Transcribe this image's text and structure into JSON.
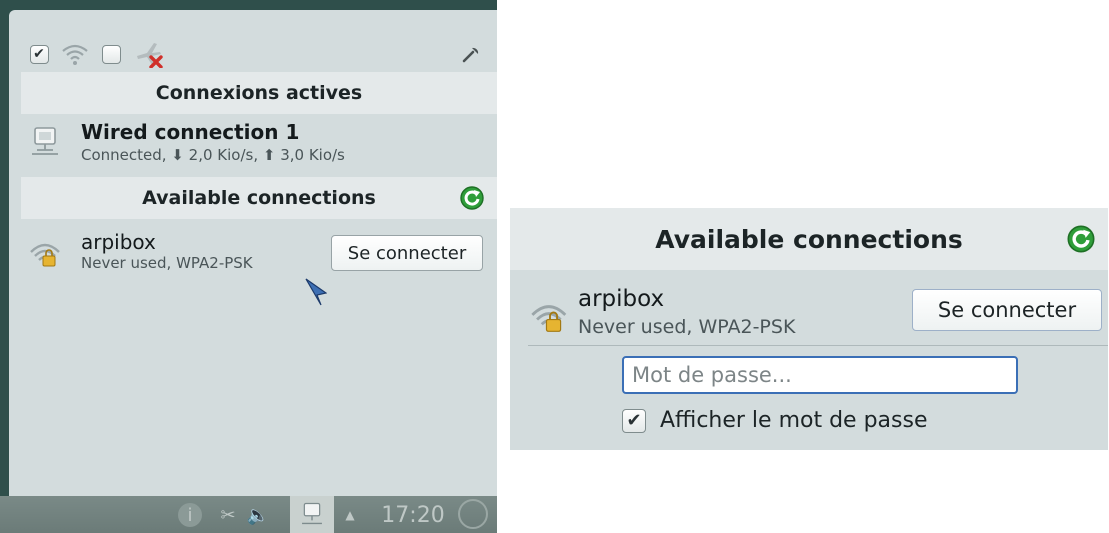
{
  "left": {
    "toolbar": {
      "networking_checkbox": "✔",
      "wifi_icon": "wifi-icon",
      "mobile_checkbox": "",
      "airplane_icon": "airplane-disabled-icon",
      "settings_icon": "wrench-icon"
    },
    "active_header": "Connexions actives",
    "wired": {
      "name": "Wired connection 1",
      "status": "Connected, ⬇ 2,0 Kio/s, ⬆ 3,0 Kio/s"
    },
    "available_header": "Available connections",
    "wifi": {
      "name": "arpibox",
      "status": "Never used, WPA2-PSK",
      "connect_label": "Se connecter"
    },
    "taskbar": {
      "info": "i",
      "clock": "17:20"
    }
  },
  "right": {
    "available_header": "Available connections",
    "wifi": {
      "name": "arpibox",
      "status": "Never used, WPA2-PSK",
      "connect_label": "Se connecter"
    },
    "password_placeholder": "Mot de passe...",
    "show_password_label": "Afficher le mot de passe",
    "show_password_checked": "✔"
  },
  "colors": {
    "panel_bg": "#d3dcdd",
    "header_bg": "#e4e9ea",
    "desktop_bg": "#2f4f4b",
    "refresh_green": "#2f9e3a",
    "focus_blue": "#3b6fb6"
  }
}
